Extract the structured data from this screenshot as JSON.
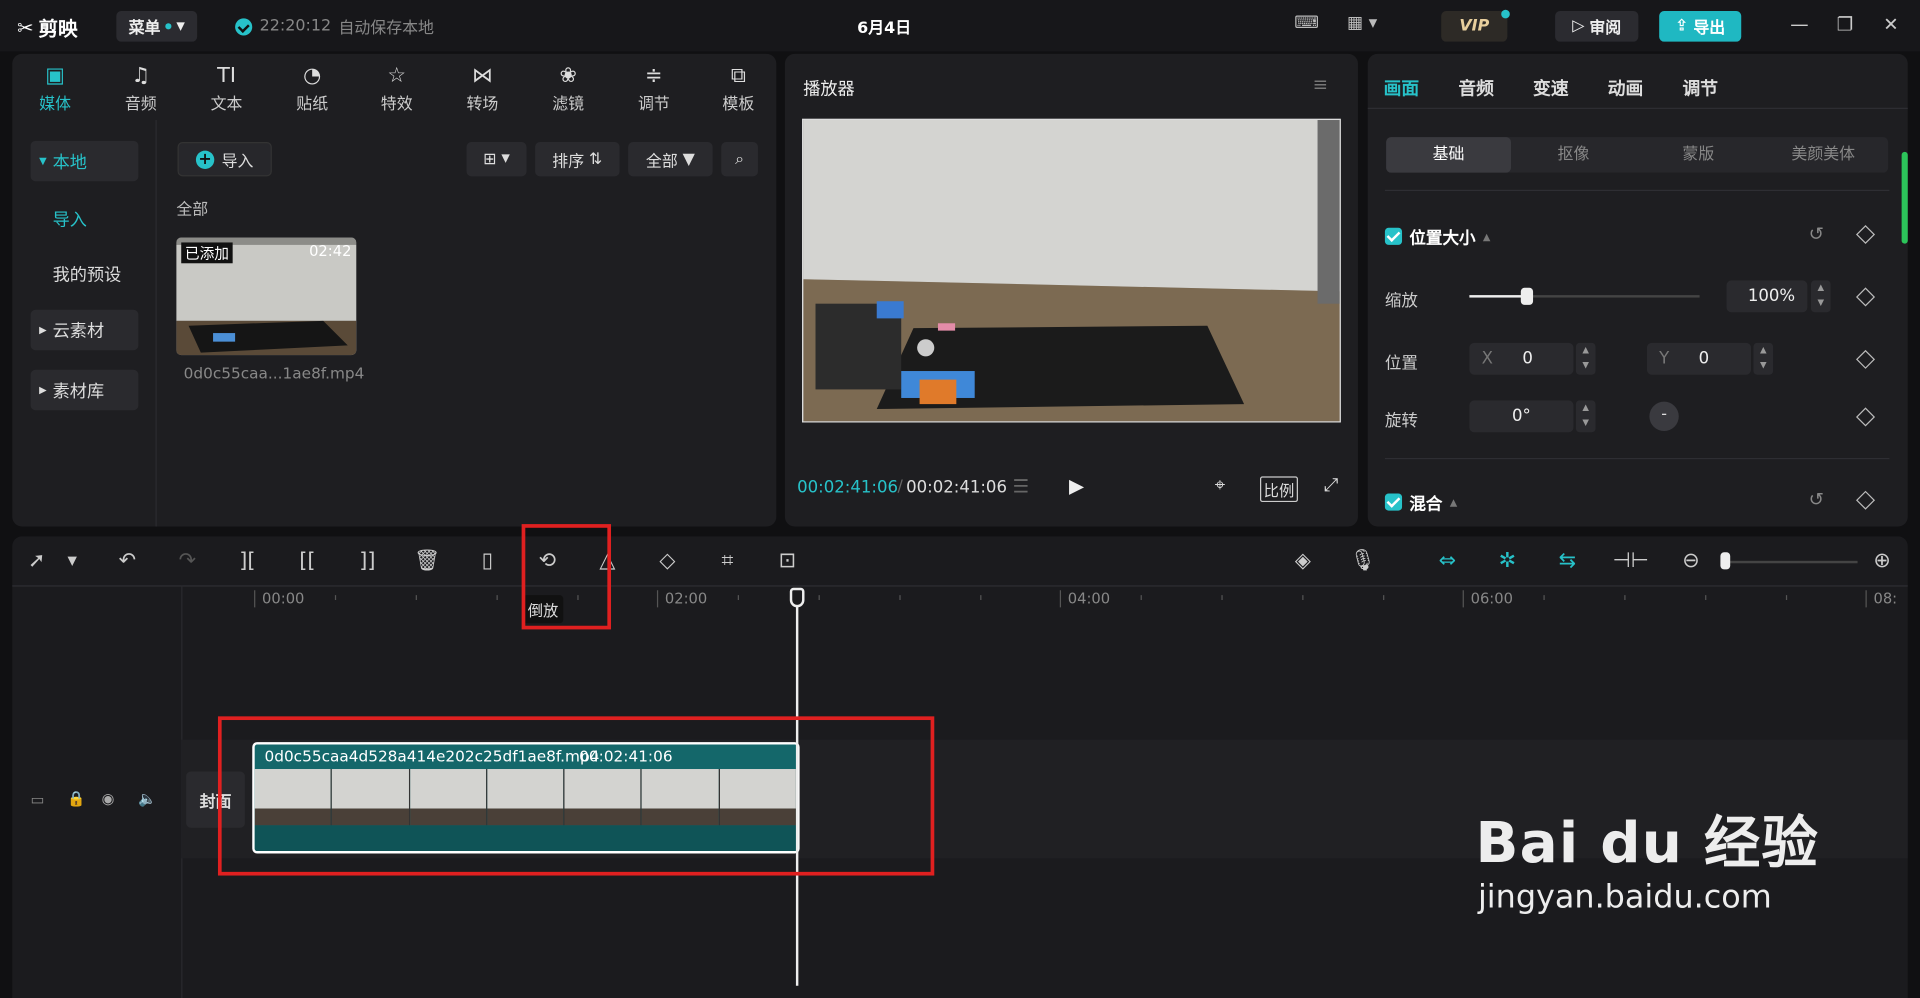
{
  "title_bar": {
    "app_name": "剪映",
    "menu_label": "菜单",
    "autosave_time": "22:20:12",
    "autosave_text": "自动保存本地",
    "doc_title": "6月4日",
    "vip_label": "VIP",
    "review_label": "审阅",
    "export_label": "导出"
  },
  "media_panel": {
    "tool_tabs": [
      {
        "label": "媒体",
        "icon": "media-icon"
      },
      {
        "label": "音频",
        "icon": "audio-icon"
      },
      {
        "label": "文本",
        "icon": "text-icon"
      },
      {
        "label": "贴纸",
        "icon": "sticker-icon"
      },
      {
        "label": "特效",
        "icon": "effects-icon"
      },
      {
        "label": "转场",
        "icon": "transition-icon"
      },
      {
        "label": "滤镜",
        "icon": "filter-icon"
      },
      {
        "label": "调节",
        "icon": "adjust-icon"
      },
      {
        "label": "模板",
        "icon": "template-icon"
      }
    ],
    "sidebar": {
      "local": "本地",
      "import": "导入",
      "my_presets": "我的预设",
      "cloud": "云素材",
      "library": "素材库"
    },
    "import_button": "导入",
    "sort_label": "排序",
    "filter_label": "全部",
    "section_label": "全部",
    "item": {
      "badge": "已添加",
      "duration": "02:42",
      "filename": "0d0c55caa...1ae8f.mp4"
    }
  },
  "player": {
    "title": "播放器",
    "current_time": "00:02:41:06",
    "total_time": "00:02:41:06",
    "ratio_label": "比例"
  },
  "properties": {
    "tabs": [
      "画面",
      "音频",
      "变速",
      "动画",
      "调节"
    ],
    "subtabs": [
      "基础",
      "抠像",
      "蒙版",
      "美颜美体"
    ],
    "position_size": "位置大小",
    "scale_label": "缩放",
    "scale_value": "100%",
    "scale_fraction": 0.25,
    "position_label": "位置",
    "x_label": "X",
    "x_value": "0",
    "y_label": "Y",
    "y_value": "0",
    "rotate_label": "旋转",
    "rotate_value": "0°",
    "blend_label": "混合"
  },
  "timeline": {
    "tooltip": "倒放",
    "ruler_labels": [
      "00:00",
      "02:00",
      "04:00",
      "06:00",
      "08:"
    ],
    "clip_name": "0d0c55caa4d528a414e202c25df1ae8f.mp4",
    "clip_duration": "00:02:41:06",
    "cover_label": "封面"
  },
  "watermark": {
    "brand": "Bai du 经验",
    "url": "jingyan.baidu.com"
  },
  "colors": {
    "accent": "#27c2c9",
    "highlight": "#e02020",
    "clip": "#14676a"
  }
}
